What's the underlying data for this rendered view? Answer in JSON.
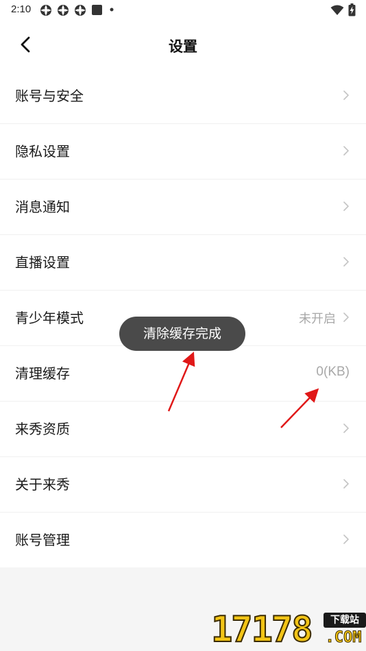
{
  "status_bar": {
    "time": "2:10",
    "notification_icons": [
      "app-icon",
      "app-icon",
      "app-icon",
      "square-icon",
      "dot-icon"
    ],
    "right_icons": [
      "wifi-icon",
      "battery-charging-icon"
    ]
  },
  "header": {
    "back_icon": "chevron-left-icon",
    "title": "设置"
  },
  "settings": {
    "items": [
      {
        "label": "账号与安全",
        "value": "",
        "has_chevron": true
      },
      {
        "label": "隐私设置",
        "value": "",
        "has_chevron": true
      },
      {
        "label": "消息通知",
        "value": "",
        "has_chevron": true
      },
      {
        "label": "直播设置",
        "value": "",
        "has_chevron": true
      },
      {
        "label": "青少年模式",
        "value": "未开启",
        "has_chevron": true
      },
      {
        "label": "清理缓存",
        "value": "0(KB)",
        "has_chevron": false
      },
      {
        "label": "来秀资质",
        "value": "",
        "has_chevron": true
      },
      {
        "label": "关于来秀",
        "value": "",
        "has_chevron": true
      },
      {
        "label": "账号管理",
        "value": "",
        "has_chevron": true
      }
    ]
  },
  "toast": {
    "text": "清除缓存完成"
  },
  "annotation": {
    "arrow_color": "#e01818"
  },
  "watermark": {
    "digits": "17178",
    "badge": "下载站",
    "suffix": ".COM"
  }
}
